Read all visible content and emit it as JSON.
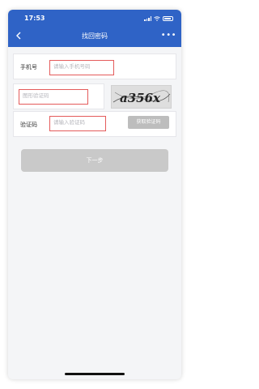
{
  "status_bar": {
    "time": "17:53"
  },
  "navbar": {
    "back_icon": "chevron-left-icon",
    "title": "找回密码",
    "more_icon": "more-dots-icon",
    "more_label": "•••"
  },
  "phone_row": {
    "label": "手机号",
    "placeholder": "请输入手机号码"
  },
  "captcha_row": {
    "placeholder": "图形验证码",
    "captcha_text": "a356x"
  },
  "code_row": {
    "label": "验证码",
    "placeholder": "请输入验证码",
    "get_code_label": "获取验证码"
  },
  "next_button": {
    "label": "下一步"
  },
  "colors": {
    "header": "#2f63c6",
    "highlight_border": "#e45b5b",
    "disabled_button": "#c9c9c9"
  }
}
